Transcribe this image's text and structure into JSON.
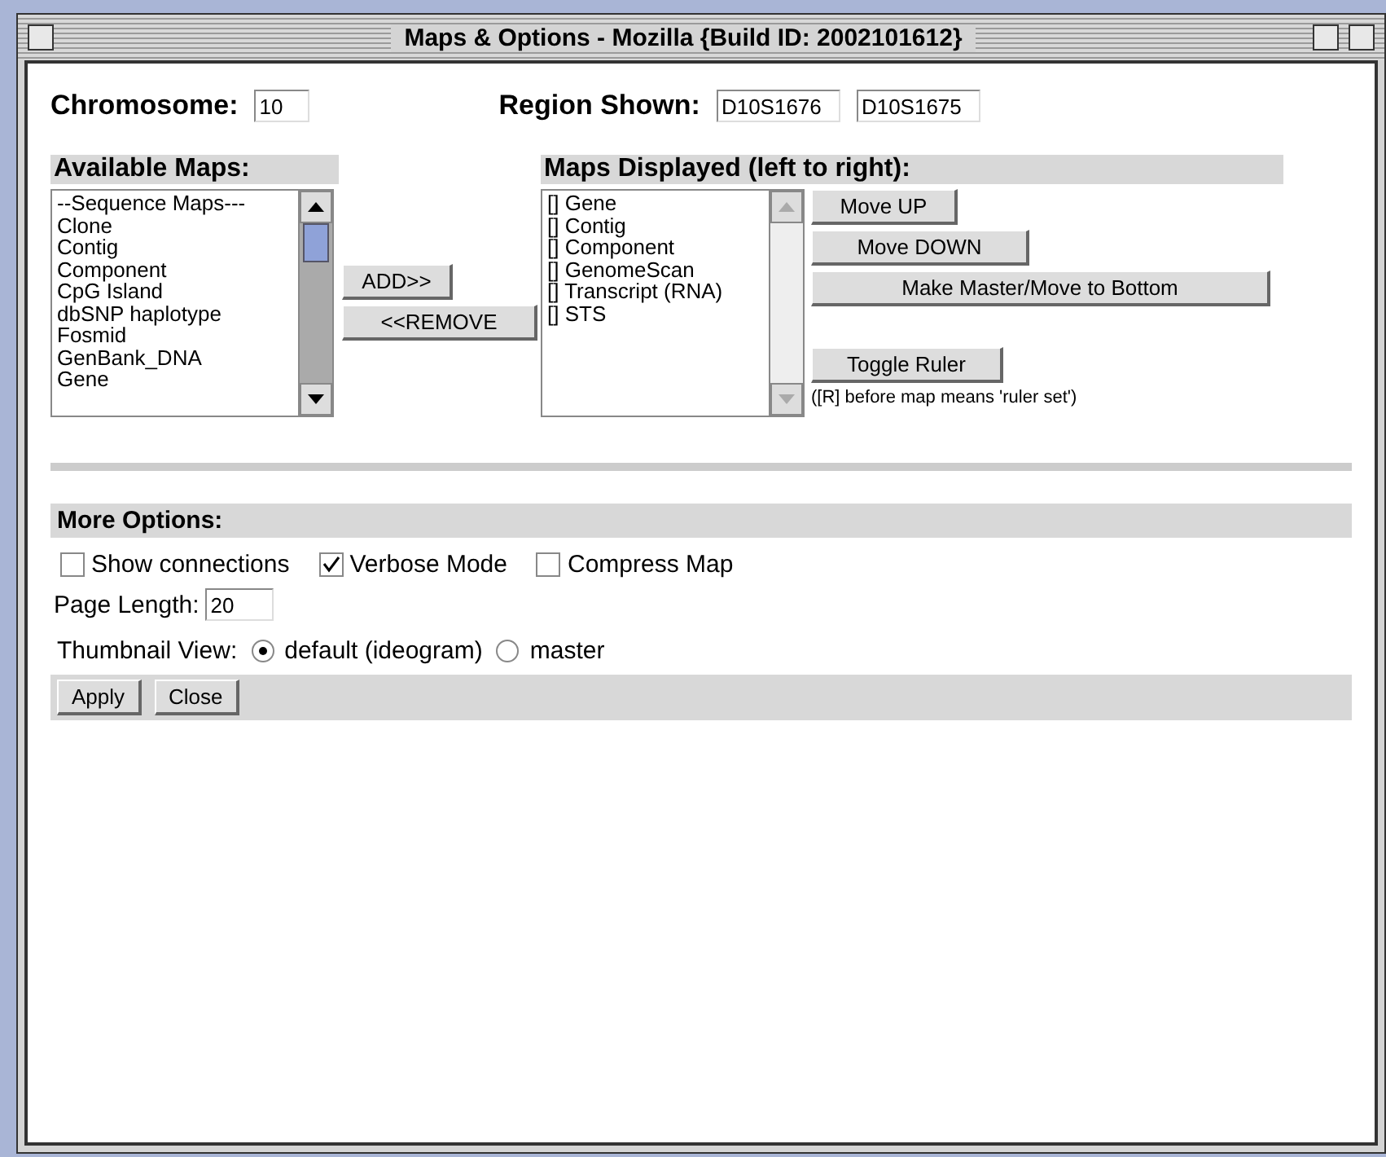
{
  "window": {
    "title": "Maps & Options - Mozilla {Build ID: 2002101612}"
  },
  "chromosome": {
    "label": "Chromosome:",
    "value": "10"
  },
  "region": {
    "label": "Region Shown:",
    "from": "D10S1676",
    "to": "D10S1675"
  },
  "available_maps": {
    "heading": "Available Maps:",
    "items": [
      "--Sequence Maps---",
      "Clone",
      "Contig",
      "Component",
      "CpG Island",
      "dbSNP haplotype",
      "Fosmid",
      "GenBank_DNA",
      "Gene"
    ]
  },
  "transfer_buttons": [
    "ADD>>",
    "<<REMOVE"
  ],
  "maps_displayed": {
    "heading": "Maps Displayed (left to right):",
    "items": [
      "[] Gene",
      "[] Contig",
      "[] Component",
      "[] GenomeScan",
      "[] Transcript (RNA)",
      "[] STS"
    ]
  },
  "order_buttons": [
    "Move UP",
    "Move DOWN",
    "Make Master/Move to Bottom"
  ],
  "ruler": {
    "button": "Toggle Ruler",
    "note": "([R] before map means 'ruler set')"
  },
  "more_options": {
    "heading": "More Options:",
    "checkboxes": [
      {
        "label": "Show connections",
        "checked": false
      },
      {
        "label": "Verbose Mode",
        "checked": true
      },
      {
        "label": "Compress Map",
        "checked": false
      }
    ],
    "page_length": {
      "label": "Page Length:",
      "value": "20"
    },
    "thumbnail": {
      "label": "Thumbnail View:",
      "options": [
        {
          "label": "default (ideogram)",
          "selected": true
        },
        {
          "label": "master",
          "selected": false
        }
      ]
    }
  },
  "buttons": [
    "Apply",
    "Close"
  ]
}
